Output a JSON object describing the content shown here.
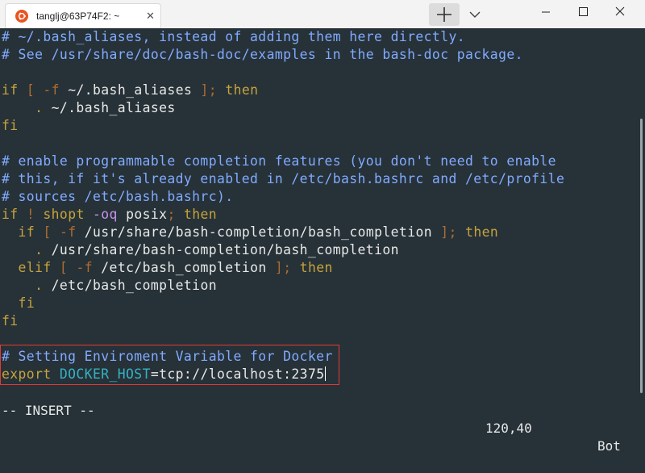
{
  "window": {
    "tab_title": "tanglj@63P74F2: ~",
    "tab_close": "✕",
    "new_tab_icon": "plus-icon",
    "dropdown_icon": "chevron-down-icon",
    "controls": [
      "minimize-icon",
      "maximize-icon",
      "close-icon"
    ]
  },
  "editor": {
    "lines": [
      {
        "segments": [
          {
            "t": "# ~/.bash_aliases, instead of adding them here directly.",
            "c": "c-comment"
          }
        ]
      },
      {
        "segments": [
          {
            "t": "# See /usr/share/doc/bash-doc/examples in the bash-doc package.",
            "c": "c-comment"
          }
        ]
      },
      {
        "segments": []
      },
      {
        "segments": [
          {
            "t": "if",
            "c": "c-kw"
          },
          {
            "t": " ",
            "c": "c-text"
          },
          {
            "t": "[",
            "c": "c-punc"
          },
          {
            "t": " ",
            "c": "c-text"
          },
          {
            "t": "-f",
            "c": "c-punc"
          },
          {
            "t": " ~/.bash_aliases ",
            "c": "c-text"
          },
          {
            "t": "];",
            "c": "c-punc"
          },
          {
            "t": " ",
            "c": "c-text"
          },
          {
            "t": "then",
            "c": "c-kw"
          }
        ]
      },
      {
        "segments": [
          {
            "t": "    ",
            "c": "c-text"
          },
          {
            "t": ".",
            "c": "c-kw"
          },
          {
            "t": " ~/.bash_aliases",
            "c": "c-text"
          }
        ]
      },
      {
        "segments": [
          {
            "t": "fi",
            "c": "c-kw"
          }
        ]
      },
      {
        "segments": []
      },
      {
        "segments": [
          {
            "t": "# enable programmable completion features (you don't need to enable",
            "c": "c-comment"
          }
        ]
      },
      {
        "segments": [
          {
            "t": "# this, if it's already enabled in /etc/bash.bashrc and /etc/profile",
            "c": "c-comment"
          }
        ]
      },
      {
        "segments": [
          {
            "t": "# sources /etc/bash.bashrc).",
            "c": "c-comment"
          }
        ]
      },
      {
        "segments": [
          {
            "t": "if",
            "c": "c-kw"
          },
          {
            "t": " ",
            "c": "c-text"
          },
          {
            "t": "!",
            "c": "c-punc"
          },
          {
            "t": " ",
            "c": "c-text"
          },
          {
            "t": "shopt",
            "c": "c-kw"
          },
          {
            "t": " ",
            "c": "c-text"
          },
          {
            "t": "-oq",
            "c": "c-opt"
          },
          {
            "t": " posix",
            "c": "c-text"
          },
          {
            "t": ";",
            "c": "c-punc"
          },
          {
            "t": " ",
            "c": "c-text"
          },
          {
            "t": "then",
            "c": "c-kw"
          }
        ]
      },
      {
        "segments": [
          {
            "t": "  ",
            "c": "c-text"
          },
          {
            "t": "if",
            "c": "c-kw"
          },
          {
            "t": " ",
            "c": "c-text"
          },
          {
            "t": "[",
            "c": "c-punc"
          },
          {
            "t": " ",
            "c": "c-text"
          },
          {
            "t": "-f",
            "c": "c-punc"
          },
          {
            "t": " /usr/share/bash-completion/bash_completion ",
            "c": "c-text"
          },
          {
            "t": "];",
            "c": "c-punc"
          },
          {
            "t": " ",
            "c": "c-text"
          },
          {
            "t": "then",
            "c": "c-kw"
          }
        ]
      },
      {
        "segments": [
          {
            "t": "    ",
            "c": "c-text"
          },
          {
            "t": ".",
            "c": "c-kw"
          },
          {
            "t": " /usr/share/bash-completion/bash_completion",
            "c": "c-text"
          }
        ]
      },
      {
        "segments": [
          {
            "t": "  ",
            "c": "c-text"
          },
          {
            "t": "elif",
            "c": "c-kw"
          },
          {
            "t": " ",
            "c": "c-text"
          },
          {
            "t": "[",
            "c": "c-punc"
          },
          {
            "t": " ",
            "c": "c-text"
          },
          {
            "t": "-f",
            "c": "c-punc"
          },
          {
            "t": " /etc/bash_completion ",
            "c": "c-text"
          },
          {
            "t": "];",
            "c": "c-punc"
          },
          {
            "t": " ",
            "c": "c-text"
          },
          {
            "t": "then",
            "c": "c-kw"
          }
        ]
      },
      {
        "segments": [
          {
            "t": "    ",
            "c": "c-text"
          },
          {
            "t": ".",
            "c": "c-kw"
          },
          {
            "t": " /etc/bash_completion",
            "c": "c-text"
          }
        ]
      },
      {
        "segments": [
          {
            "t": "  ",
            "c": "c-text"
          },
          {
            "t": "fi",
            "c": "c-kw"
          }
        ]
      },
      {
        "segments": [
          {
            "t": "fi",
            "c": "c-kw"
          }
        ]
      },
      {
        "segments": []
      },
      {
        "segments": [
          {
            "t": "# Setting Enviroment Variable for Docker",
            "c": "c-comment"
          }
        ]
      },
      {
        "segments": [
          {
            "t": "export",
            "c": "c-kw"
          },
          {
            "t": " ",
            "c": "c-text"
          },
          {
            "t": "DOCKER_HOST",
            "c": "c-var"
          },
          {
            "t": "=",
            "c": "c-eq"
          },
          {
            "t": "tcp://localhost:2375",
            "c": "c-text"
          }
        ],
        "cursor": true
      }
    ]
  },
  "status": {
    "mode": "-- INSERT --",
    "position": "120,40",
    "scroll": "Bot"
  },
  "colors": {
    "background": "#263238",
    "comment": "#82aaff",
    "keyword": "#c8a23c",
    "variable": "#34b2c4",
    "highlight_box": "#e53935"
  }
}
